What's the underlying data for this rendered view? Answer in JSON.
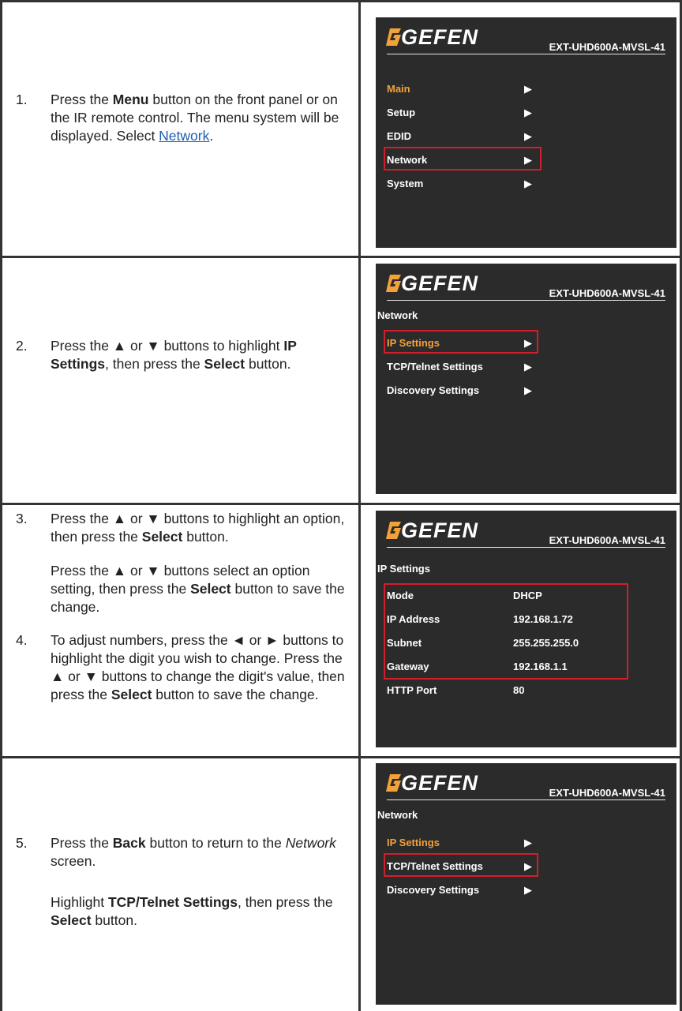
{
  "brand": {
    "logo": "GEFEN",
    "model": "EXT-UHD600A-MVSL-41",
    "logo_color": "#f3a23a",
    "active_item_color": "#f3a23a",
    "highlight_color": "#d01f2b"
  },
  "steps": {
    "s1": {
      "num": "1.",
      "p1": "Press the ",
      "b1": "Menu",
      "p2": " button on the front panel or on the IR remote control. The menu system will be displayed. Select ",
      "link": "Network",
      "p3": "."
    },
    "s2": {
      "num": "2.",
      "p1": "Press the ▲ or ▼ buttons to highlight ",
      "b1": "IP Settings",
      "p2": ", then press the ",
      "b2": "Select",
      "p3": " button."
    },
    "s3": {
      "num": "3.",
      "p1": "Press the ▲ or ▼ buttons to highlight an option, then press the ",
      "b1": "Select",
      "p2": " button.",
      "p3": "Press the ▲ or ▼ buttons select an option setting, then press the ",
      "b2": "Select",
      "p4": " button to save the change."
    },
    "s4": {
      "num": "4.",
      "p1": "To adjust numbers, press the ◄ or ► buttons to highlight the digit you wish to change.  Press the ▲ or ▼ buttons to change the digit's value, then press the ",
      "b1": "Select",
      "p2": " button to save the change."
    },
    "s5": {
      "num": "5.",
      "p1": "Press the ",
      "b1": "Back",
      "p2": " button to return to the ",
      "i1": "Network",
      "p3": " screen.",
      "p4": "Highlight ",
      "b2": "TCP/Telnet Settings",
      "p5": ", then press the ",
      "b3": "Select",
      "p6": " button."
    }
  },
  "screens": {
    "main_menu": {
      "items": [
        "Main",
        "Setup",
        "EDID",
        "Network",
        "System"
      ],
      "arrow": "▶"
    },
    "network1": {
      "title": "Network",
      "items": [
        "IP Settings",
        "TCP/Telnet Settings",
        "Discovery Settings"
      ],
      "arrow": "▶"
    },
    "ip_settings": {
      "title": "IP Settings",
      "rows": [
        {
          "label": "Mode",
          "value": "DHCP"
        },
        {
          "label": "IP Address",
          "value": "192.168.1.72"
        },
        {
          "label": "Subnet",
          "value": "255.255.255.0"
        },
        {
          "label": "Gateway",
          "value": "192.168.1.1"
        },
        {
          "label": "HTTP Port",
          "value": "80"
        }
      ]
    },
    "network2": {
      "title": "Network",
      "items": [
        "IP Settings",
        "TCP/Telnet Settings",
        "Discovery Settings"
      ],
      "arrow": "▶"
    }
  }
}
